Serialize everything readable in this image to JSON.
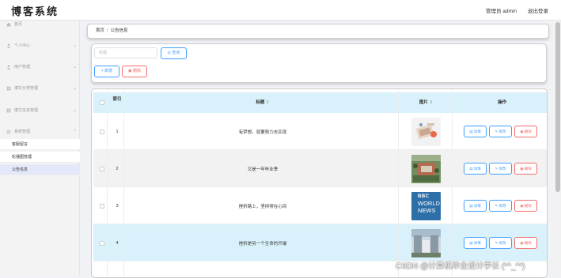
{
  "app": {
    "logo": "博客系统",
    "user": "管理员 admin",
    "logout": "退出登录"
  },
  "sidebar": {
    "items": [
      {
        "label": "首页",
        "icon": "home-icon"
      },
      {
        "label": "个人中心",
        "icon": "user-icon"
      },
      {
        "label": "用户管理",
        "icon": "user-icon"
      },
      {
        "label": "博文分类管理",
        "icon": "grid-icon"
      },
      {
        "label": "博文信息管理",
        "icon": "grid-icon"
      },
      {
        "label": "系统管理",
        "icon": "gear-icon"
      }
    ],
    "subitems": [
      {
        "label": "客服留言"
      },
      {
        "label": "轮播图管理"
      },
      {
        "label": "公告信息"
      }
    ]
  },
  "breadcrumb": {
    "home": "首页",
    "current": "公告信息"
  },
  "search": {
    "placeholder": "标题",
    "search_label": "查询",
    "add_label": "+ 新增",
    "delete_label": "删除"
  },
  "table": {
    "headers": {
      "index": "索引",
      "title": "标题",
      "image": "图片",
      "actions": "操作"
    },
    "rows": [
      {
        "index": "1",
        "title": "有梦想，就要努力去实现",
        "image": "illustration"
      },
      {
        "index": "2",
        "title": "又是一年毕业季",
        "image": "campus"
      },
      {
        "index": "3",
        "title": "挫折路上，坚持常在心间",
        "image": "bbc"
      },
      {
        "index": "4",
        "title": "挫折是另一个生命的开端",
        "image": "building"
      }
    ],
    "actions": {
      "detail": "详情",
      "edit": "修改",
      "delete": "删除"
    },
    "bbc": {
      "line1": "BBC",
      "line2": "WORLD",
      "line3": "NEWS"
    }
  },
  "watermark": "CSDN @计算机毕业设计学长 (*^_^*)",
  "colors": {
    "primary": "#409eff",
    "danger": "#f56c6c",
    "header_bg": "#d9f1fb",
    "active_sub": "#e4e8fb"
  }
}
